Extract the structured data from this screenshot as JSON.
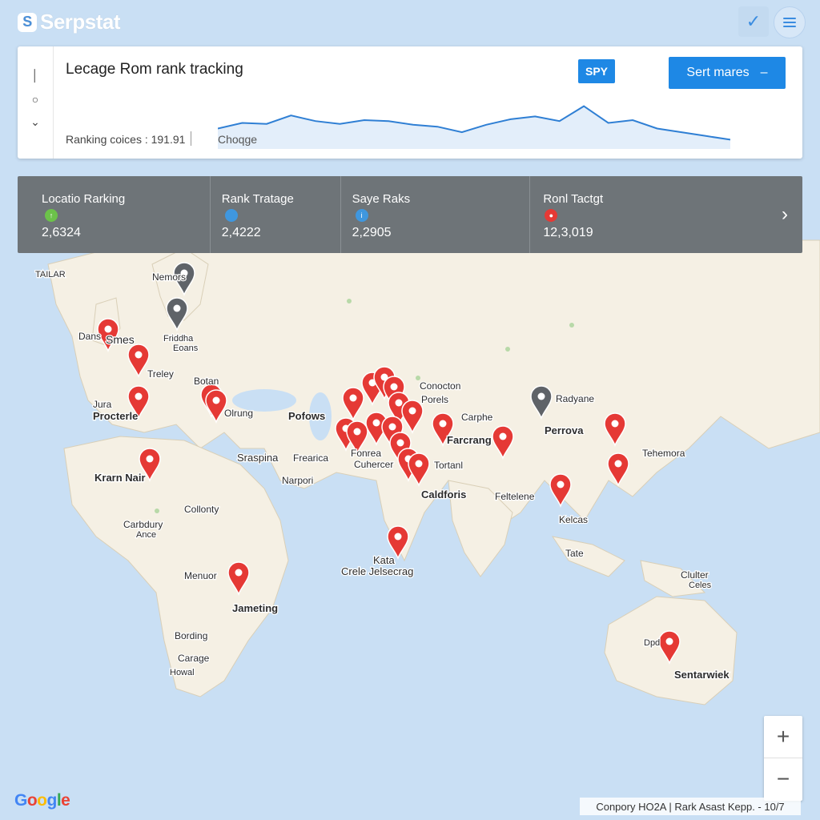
{
  "app": {
    "logo_text": "Serpstat",
    "logo_mark": "S"
  },
  "topbar": {
    "check_icon": "check-icon",
    "menu_icon": "menu-icon"
  },
  "panel": {
    "title": "Lecage Rom rank tracking",
    "spy_label": "SPY",
    "sort_label": "Sert mares",
    "rank_label": "Ranking coices : 191.91",
    "chart_caption": "Choqge",
    "rail_icons": [
      "line-icon",
      "circle-icon",
      "chevron-down-icon"
    ]
  },
  "sparkline": {
    "values": [
      22,
      28,
      27,
      36,
      30,
      27,
      31,
      30,
      26,
      24,
      18,
      26,
      32,
      35,
      30,
      46,
      28,
      31,
      22,
      18,
      14,
      10
    ]
  },
  "stats": [
    {
      "label": "Locatio Rarking",
      "value": "2,6324",
      "dot_color": "#6cc24a",
      "dot_glyph": "↑"
    },
    {
      "label": "Rank Tratage",
      "value": "2,4222",
      "dot_color": "#3f97df",
      "dot_glyph": ""
    },
    {
      "label": "Saye Raks",
      "value": "2,2905",
      "dot_color": "#3f97df",
      "dot_glyph": "i"
    },
    {
      "label": "Ronl Tactgt",
      "value": "12,3,019",
      "dot_color": "#e53935",
      "dot_glyph": "●"
    }
  ],
  "stats_next_icon": "chevron-right-icon",
  "map_labels": [
    "TAILAR",
    "Nemors",
    "Friddha",
    "Eoans",
    "Dans",
    "Smes",
    "Treley",
    "Botan",
    "Jura",
    "Procterle",
    "Olrung",
    "Pofows",
    "Conocton",
    "Porels",
    "Carphe",
    "Farcrang",
    "Tortanl",
    "Radyane",
    "Perrova",
    "Tehemora",
    "Fonrea",
    "Frearica",
    "Cuhercer",
    "Caldforis",
    "Feltelene",
    "Krarn Nair",
    "Sraspina",
    "Narpori",
    "Collonty",
    "Carbdury",
    "Ance",
    "Kelcas",
    "Tate",
    "Kata",
    "Crele Jelsecrag",
    "Menuor",
    "Jameting",
    "Bording",
    "Carage",
    "Howal",
    "Clulter",
    "Celes",
    "Dpd",
    "Sentarwiek"
  ],
  "pin_colors": {
    "red": "#e53935",
    "gray": "#5f6368"
  },
  "zoom": {
    "in_label": "+",
    "out_label": "−"
  },
  "footer": {
    "google_letters": [
      "G",
      "o",
      "o",
      "g",
      "l",
      "e"
    ],
    "attribution": "Conpory HO2A | Rark Asast Kepp. - 10/7"
  }
}
